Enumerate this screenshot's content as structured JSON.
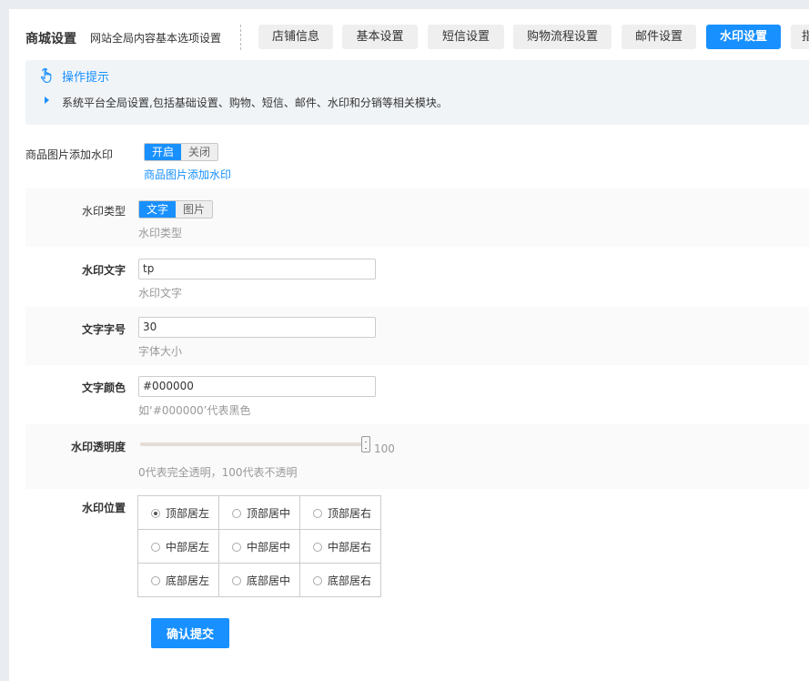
{
  "header": {
    "title": "商城设置",
    "subtitle": "网站全局内容基本选项设置",
    "tabs": [
      {
        "label": "店铺信息",
        "active": false
      },
      {
        "label": "基本设置",
        "active": false
      },
      {
        "label": "短信设置",
        "active": false
      },
      {
        "label": "购物流程设置",
        "active": false
      },
      {
        "label": "邮件设置",
        "active": false
      },
      {
        "label": "水印设置",
        "active": true
      },
      {
        "label": "指",
        "active": false
      }
    ]
  },
  "tips": {
    "icon": "hand-pointer-icon",
    "title": "操作提示",
    "items": [
      "系统平台全局设置,包括基础设置、购物、短信、邮件、水印和分销等相关模块。"
    ]
  },
  "form": {
    "watermark_enable": {
      "label": "商品图片添加水印",
      "options": [
        "开启",
        "关闭"
      ],
      "selected": "开启",
      "hint": "商品图片添加水印"
    },
    "watermark_type": {
      "label": "水印类型",
      "options": [
        "文字",
        "图片"
      ],
      "selected": "文字",
      "hint": "水印类型"
    },
    "watermark_text": {
      "label": "水印文字",
      "value": "tp",
      "hint": "水印文字"
    },
    "font_size": {
      "label": "文字字号",
      "value": "30",
      "hint": "字体大小"
    },
    "font_color": {
      "label": "文字颜色",
      "value": "#000000",
      "hint": "如‘#000000’代表黑色"
    },
    "opacity": {
      "label": "水印透明度",
      "value": "100",
      "level": 1.0,
      "hint": "0代表完全透明，100代表不透明"
    },
    "position": {
      "label": "水印位置",
      "options": [
        [
          "顶部居左",
          "顶部居中",
          "顶部居右"
        ],
        [
          "中部居左",
          "中部居中",
          "中部居右"
        ],
        [
          "底部居左",
          "底部居中",
          "底部居右"
        ]
      ],
      "selected": "顶部居左"
    },
    "submit_label": "确认提交"
  },
  "colors": {
    "accent": "#1890ff",
    "background": "#e9ecf0",
    "tips_bg": "#f1f4f7"
  }
}
